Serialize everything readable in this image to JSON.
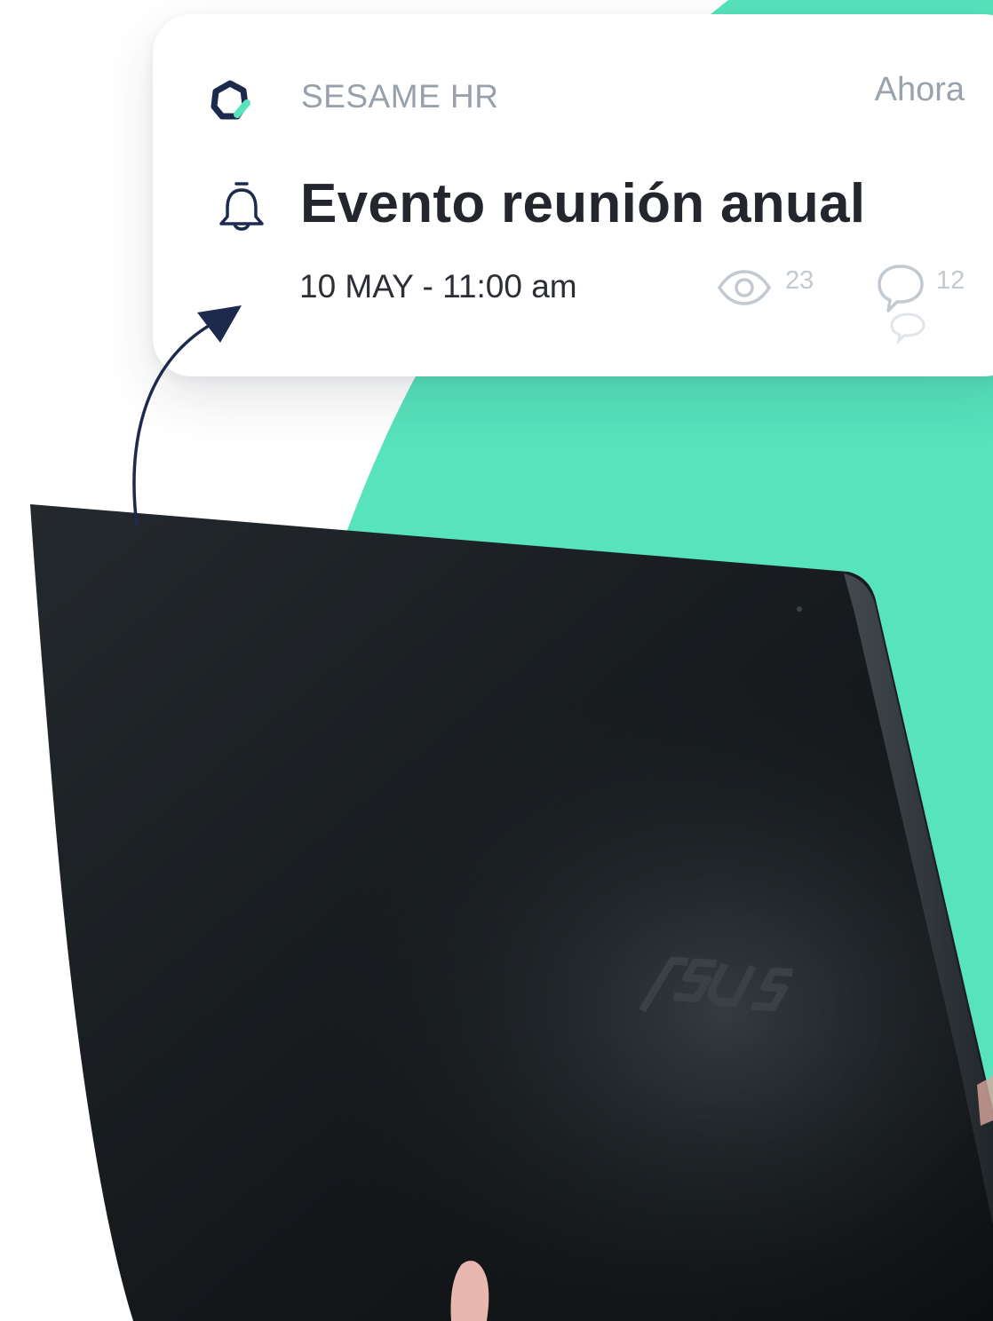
{
  "notification": {
    "app_name": "SESAME HR",
    "time": "Ahora",
    "title": "Evento reunión anual",
    "date": "10 MAY - 11:00 am",
    "views": "23",
    "comments": "12"
  },
  "laptop": {
    "brand_logo": "ASUS"
  },
  "icons": {
    "app": "sesame-logo-icon",
    "event": "bell-icon",
    "views": "eye-icon",
    "comments": "speech-bubble-icon",
    "pointer": "curved-arrow-icon"
  },
  "colors": {
    "accent_green": "#57e3bc",
    "navy": "#1d2a4d",
    "laptop": "#161a1d",
    "title_text": "#23262d",
    "muted_text": "#97a0ab"
  }
}
